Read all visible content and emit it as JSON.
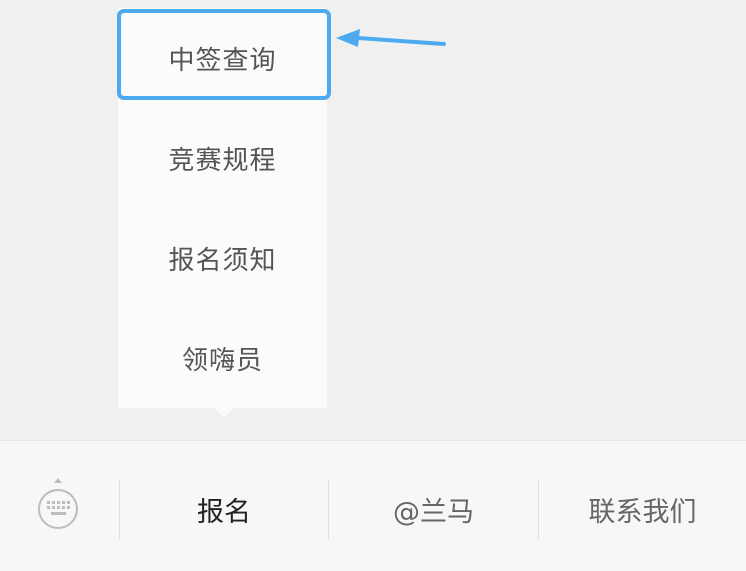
{
  "popup_menu": {
    "items": [
      {
        "label": "中签查询",
        "highlighted": true
      },
      {
        "label": "竞赛规程"
      },
      {
        "label": "报名须知"
      },
      {
        "label": "领嗨员"
      }
    ]
  },
  "annotation": {
    "color": "#4daaf0",
    "arrow_icon": "arrow-left-icon"
  },
  "bottom_bar": {
    "keyboard_icon": "keyboard-icon",
    "items": [
      {
        "label": "报名",
        "active": true
      },
      {
        "label": "@兰马"
      },
      {
        "label": "联系我们"
      }
    ]
  }
}
